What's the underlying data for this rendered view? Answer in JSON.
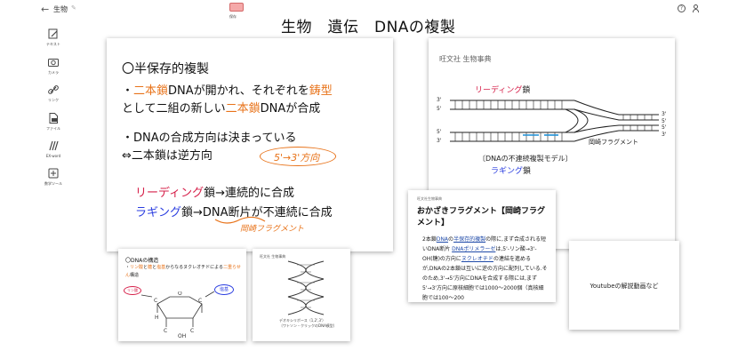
{
  "app": {
    "back_icon": "back-arrow-icon",
    "doc_title": "生物",
    "save_label": "保存"
  },
  "toolbar": {
    "items": [
      {
        "label": "テキスト",
        "icon": "text-edit-icon"
      },
      {
        "label": "カメラ",
        "icon": "camera-icon"
      },
      {
        "label": "リンク",
        "icon": "link-icon"
      },
      {
        "label": "ファイル",
        "icon": "file-icon"
      },
      {
        "label": "EX-word",
        "icon": "dictionary-icon"
      },
      {
        "label": "数学ツール",
        "icon": "math-tool-icon"
      }
    ]
  },
  "canvas": {
    "title": "生物　遺伝　DNAの複製"
  },
  "main_card": {
    "heading": "〇半保存的複製",
    "line1_a": "・",
    "line1_b": "二本鎖",
    "line1_c": "DNAが開かれ、それぞれを",
    "line1_d": "鋳型",
    "line2_a": "として二組の新しい",
    "line2_b": "二本鎖",
    "line2_c": "DNAが合成",
    "line3": "・DNAの合成方向は決まっている",
    "line4": "⇔二本鎖は逆方向",
    "note_direction": "5'→3'方向",
    "line5_a": "リーディング",
    "line5_b": "鎖→連続的に合成",
    "line6_a": "ラギング",
    "line6_b": "鎖→",
    "line6_c": "DNA断片",
    "line6_d": "が不連続に合成",
    "note_fragment": "岡崎フラグメント"
  },
  "textbook_card": {
    "source": "旺文社 生物事典",
    "leading": "リーディング",
    "leading_suffix": "鎖",
    "fragment_label": "岡崎フラグメント",
    "caption": "〔DNAの不連続複製モデル〕",
    "lagging": "ラギング",
    "lagging_suffix": "鎖",
    "end_labels": [
      "3'",
      "5'",
      "5'",
      "3'",
      "3'",
      "5'",
      "5'",
      "3'"
    ]
  },
  "kotobank_card": {
    "source": "旺文社生物事典",
    "title": "おかざきフラグメント【岡崎フラグメント】",
    "body_1": "2本鎖",
    "link_1": "DNA",
    "body_2": "の",
    "link_2": "半保存的複製",
    "body_3": "の際に,まず合成される短いDNA断片",
    "link_3": "DNAポリメラーゼ",
    "body_4": "は,5'-リン酸→3'-OH(糖)の方向に",
    "link_4": "ヌクレオチド",
    "body_5": "の連結を進めるが,DNAの2本鎖は互いに逆の方向に配列している.そのため,3'→5'方向にDNAを合成する際には,まず5'→3'方向に原核細胞では1000〜2000個（真核細胞では100〜200"
  },
  "structure_card": {
    "title": "〇DNAの構造",
    "desc_a": "・",
    "desc_b": "リン酸",
    "desc_c": "と",
    "desc_d": "糖",
    "desc_e": "と",
    "desc_f": "塩基",
    "desc_g": "からなるヌクレオチドによる",
    "desc_h": "二重らせん",
    "desc_i": "構造",
    "tag_left": "リン酸",
    "tag_right": "塩基"
  },
  "dna_image_card": {
    "source": "旺文社 生物事典",
    "caption_1": "デオキシリボース（1,2',3'）",
    "caption_2": "〔ワトソン・クリックのDNA模型〕"
  },
  "youtube_card": {
    "label": "Youtubeの解説動画など"
  },
  "colors": {
    "orange": "#e8731a",
    "red": "#d6204a",
    "blue": "#2a3de0",
    "link": "#1f4aa8"
  }
}
